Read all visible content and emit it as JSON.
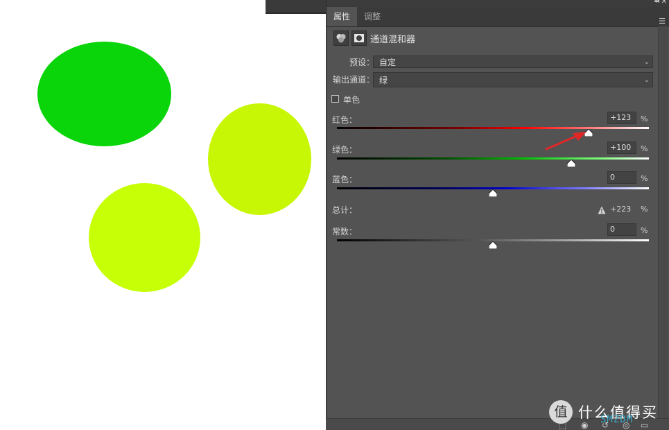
{
  "canvas": {
    "ellipses": [
      {
        "name": "green-ellipse",
        "color": "#0ad40a"
      },
      {
        "name": "yellow-green-ellipse-right",
        "color": "#c8f705"
      },
      {
        "name": "yellow-green-ellipse-bottom",
        "color": "#c6ff06"
      }
    ]
  },
  "panel": {
    "tabs": [
      {
        "label": "属性",
        "active": true
      },
      {
        "label": "调整",
        "active": false
      }
    ],
    "header_title": "通道混和器",
    "preset_label": "预设：",
    "preset_value": "自定",
    "output_label": "输出通道：",
    "output_value": "绿",
    "monochrome_label": "单色",
    "monochrome_checked": false,
    "channels": [
      {
        "label": "红色：",
        "value": "+123",
        "percent": "%",
        "slider_value": 123,
        "color": "#ff8080"
      },
      {
        "label": "绿色：",
        "value": "+100",
        "percent": "%",
        "slider_value": 100,
        "color": "#80ff80"
      },
      {
        "label": "蓝色：",
        "value": "0",
        "percent": "%",
        "slider_value": 0,
        "color": "#8080ff"
      }
    ],
    "total_label": "总计：",
    "total_value": "+223",
    "total_percent": "%",
    "constant_label": "常数：",
    "constant_value": "0",
    "constant_percent": "%",
    "constant_slider_value": 0
  },
  "watermark": {
    "logo_char": "值",
    "text": "什么值得买",
    "sub": "SMZDM"
  }
}
